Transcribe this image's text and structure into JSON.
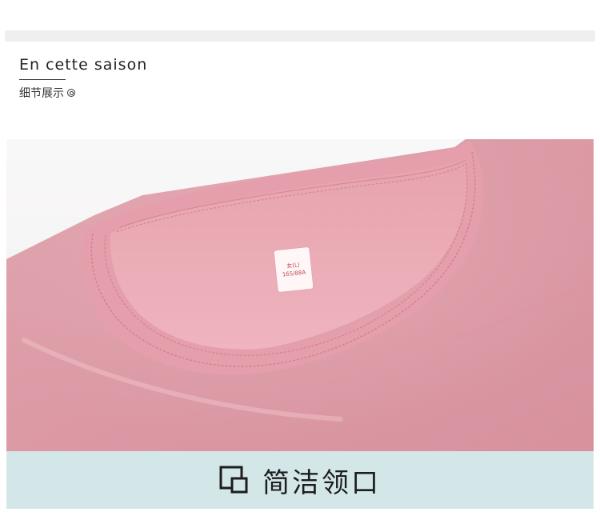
{
  "header": {
    "title": "En cette saison",
    "subtitle": "细节展示"
  },
  "tag": {
    "line1": "女(L)",
    "line2": "165/88A"
  },
  "caption": {
    "text": "简洁领口",
    "icon": "square-overlap-icon"
  },
  "colors": {
    "fabric": "#e9aab4",
    "fabric_dark": "#d98e9a",
    "caption_bg": "#d3e7e9",
    "background_top": "#f7f7f7"
  }
}
